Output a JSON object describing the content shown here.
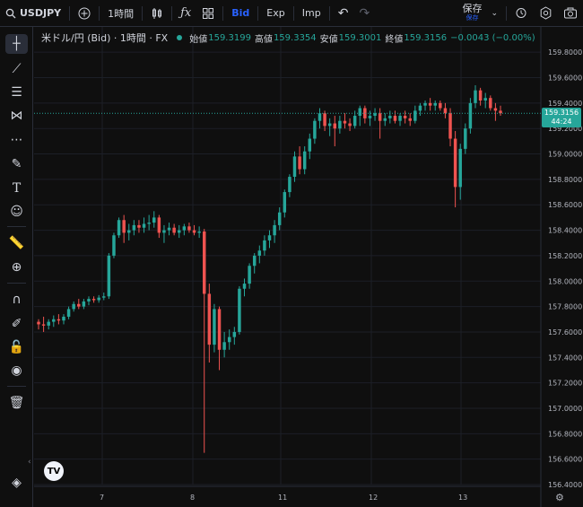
{
  "toolbar": {
    "symbol": "USDJPY",
    "interval": "1時間",
    "bid": "Bid",
    "exp": "Exp",
    "imp": "Imp",
    "save_label": "保存",
    "save_sub": "保存",
    "accent": "#2962ff"
  },
  "legend": {
    "title": "米ドル/円 (Bid) · 1時間 · FX",
    "open_label": "始値",
    "open": "159.3199",
    "high_label": "高値",
    "high": "159.3354",
    "low_label": "安値",
    "low": "159.3001",
    "close_label": "終値",
    "close": "159.3156",
    "change": "−0.0043 (−0.00%)"
  },
  "price_tag": {
    "price": "159.3156",
    "countdown": "44:24",
    "color": "#26a69a"
  },
  "sidebar_icons": [
    "crosshair-icon",
    "trendline-icon",
    "fib-icon",
    "pattern-icon",
    "measure-icon",
    "brush-icon",
    "text-icon",
    "emoji-icon",
    "ruler-icon",
    "zoom-in-icon",
    "magnet-icon",
    "lock-drawing-icon",
    "lock-icon",
    "eye-icon",
    "trash-icon",
    "layers-icon"
  ],
  "chart_data": {
    "type": "candlestick",
    "title": "米ドル/円 (Bid) · 1時間 · FX",
    "ylim": [
      156.4,
      159.9
    ],
    "y_ticks": [
      "159.8000",
      "159.6000",
      "159.4000",
      "159.2000",
      "159.0000",
      "158.8000",
      "158.6000",
      "158.4000",
      "158.2000",
      "158.0000",
      "157.8000",
      "157.6000",
      "157.4000",
      "157.2000",
      "157.0000",
      "156.8000",
      "156.6000",
      "156.4000"
    ],
    "x_ticks": [
      "7",
      "8",
      "11",
      "12",
      "13"
    ],
    "up_color": "#26a69a",
    "down_color": "#ef5350",
    "candles": [
      [
        157.68,
        157.7,
        157.62,
        157.66
      ],
      [
        157.66,
        157.72,
        157.6,
        157.65
      ],
      [
        157.65,
        157.7,
        157.62,
        157.68
      ],
      [
        157.68,
        157.73,
        157.64,
        157.7
      ],
      [
        157.7,
        157.74,
        157.66,
        157.69
      ],
      [
        157.69,
        157.74,
        157.66,
        157.72
      ],
      [
        157.72,
        157.8,
        157.7,
        157.78
      ],
      [
        157.78,
        157.84,
        157.76,
        157.82
      ],
      [
        157.82,
        157.86,
        157.78,
        157.8
      ],
      [
        157.8,
        157.86,
        157.78,
        157.84
      ],
      [
        157.84,
        157.88,
        157.81,
        157.86
      ],
      [
        157.86,
        157.88,
        157.83,
        157.85
      ],
      [
        157.85,
        157.89,
        157.83,
        157.87
      ],
      [
        157.87,
        157.91,
        157.85,
        157.88
      ],
      [
        157.88,
        158.22,
        157.86,
        158.2
      ],
      [
        158.2,
        158.38,
        158.18,
        158.36
      ],
      [
        158.36,
        158.5,
        158.34,
        158.48
      ],
      [
        158.48,
        158.52,
        158.3,
        158.38
      ],
      [
        158.38,
        158.45,
        158.32,
        158.4
      ],
      [
        158.4,
        158.48,
        158.36,
        158.44
      ],
      [
        158.44,
        158.48,
        158.38,
        158.42
      ],
      [
        158.42,
        158.5,
        158.38,
        158.45
      ],
      [
        158.45,
        158.52,
        158.4,
        158.46
      ],
      [
        158.46,
        158.55,
        158.42,
        158.5
      ],
      [
        158.5,
        158.52,
        158.34,
        158.38
      ],
      [
        158.38,
        158.44,
        158.3,
        158.4
      ],
      [
        158.4,
        158.46,
        158.36,
        158.42
      ],
      [
        158.42,
        158.45,
        158.36,
        158.38
      ],
      [
        158.38,
        158.44,
        158.34,
        158.4
      ],
      [
        158.4,
        158.45,
        158.36,
        158.43
      ],
      [
        158.43,
        158.46,
        158.38,
        158.4
      ],
      [
        158.4,
        158.44,
        158.36,
        158.38
      ],
      [
        158.38,
        158.43,
        158.34,
        158.39
      ],
      [
        158.39,
        158.41,
        156.65,
        157.9
      ],
      [
        157.9,
        157.98,
        157.36,
        157.5
      ],
      [
        157.5,
        157.82,
        157.44,
        157.78
      ],
      [
        157.78,
        157.8,
        157.3,
        157.46
      ],
      [
        157.46,
        157.6,
        157.4,
        157.52
      ],
      [
        157.52,
        157.62,
        157.46,
        157.56
      ],
      [
        157.56,
        157.64,
        157.5,
        157.6
      ],
      [
        157.6,
        157.96,
        157.58,
        157.94
      ],
      [
        157.94,
        158.02,
        157.88,
        157.98
      ],
      [
        157.98,
        158.14,
        157.94,
        158.12
      ],
      [
        158.12,
        158.22,
        158.06,
        158.2
      ],
      [
        158.2,
        158.28,
        158.14,
        158.24
      ],
      [
        158.24,
        158.36,
        158.2,
        158.32
      ],
      [
        158.32,
        158.4,
        158.26,
        158.36
      ],
      [
        158.36,
        158.48,
        158.3,
        158.44
      ],
      [
        158.44,
        158.58,
        158.4,
        158.54
      ],
      [
        158.54,
        158.72,
        158.5,
        158.7
      ],
      [
        158.7,
        158.84,
        158.66,
        158.82
      ],
      [
        158.82,
        159.02,
        158.78,
        158.98
      ],
      [
        158.98,
        159.06,
        158.84,
        158.88
      ],
      [
        158.88,
        159.06,
        158.84,
        159.02
      ],
      [
        159.02,
        159.16,
        158.96,
        159.12
      ],
      [
        159.12,
        159.28,
        159.08,
        159.26
      ],
      [
        159.26,
        159.36,
        159.2,
        159.32
      ],
      [
        159.32,
        159.34,
        159.18,
        159.22
      ],
      [
        159.22,
        159.28,
        159.14,
        159.24
      ],
      [
        159.24,
        159.3,
        159.06,
        159.2
      ],
      [
        159.2,
        159.3,
        159.16,
        159.26
      ],
      [
        159.26,
        159.32,
        159.2,
        159.24
      ],
      [
        159.24,
        159.28,
        159.18,
        159.22
      ],
      [
        159.22,
        159.34,
        159.2,
        159.3
      ],
      [
        159.3,
        159.38,
        159.22,
        159.36
      ],
      [
        159.36,
        159.38,
        159.24,
        159.28
      ],
      [
        159.28,
        159.34,
        159.22,
        159.3
      ],
      [
        159.3,
        159.36,
        159.26,
        159.32
      ],
      [
        159.32,
        159.36,
        159.12,
        159.26
      ],
      [
        159.26,
        159.32,
        159.22,
        159.28
      ],
      [
        159.28,
        159.34,
        159.24,
        159.3
      ],
      [
        159.3,
        159.34,
        159.24,
        159.26
      ],
      [
        159.26,
        159.32,
        159.22,
        159.3
      ],
      [
        159.3,
        159.34,
        159.24,
        159.28
      ],
      [
        159.28,
        159.32,
        159.22,
        159.26
      ],
      [
        159.26,
        159.38,
        159.24,
        159.34
      ],
      [
        159.34,
        159.4,
        159.3,
        159.38
      ],
      [
        159.38,
        159.42,
        159.34,
        159.4
      ],
      [
        159.4,
        159.44,
        159.34,
        159.38
      ],
      [
        159.38,
        159.42,
        159.34,
        159.4
      ],
      [
        159.4,
        159.42,
        159.34,
        159.36
      ],
      [
        159.36,
        159.4,
        159.28,
        159.32
      ],
      [
        159.32,
        159.36,
        159.06,
        159.12
      ],
      [
        159.12,
        159.18,
        158.58,
        158.74
      ],
      [
        158.74,
        159.08,
        158.64,
        159.04
      ],
      [
        159.04,
        159.24,
        159.0,
        159.2
      ],
      [
        159.2,
        159.44,
        159.16,
        159.4
      ],
      [
        159.4,
        159.54,
        159.36,
        159.5
      ],
      [
        159.5,
        159.52,
        159.38,
        159.42
      ],
      [
        159.42,
        159.48,
        159.36,
        159.44
      ],
      [
        159.44,
        159.46,
        159.34,
        159.36
      ],
      [
        159.36,
        159.4,
        159.26,
        159.34
      ],
      [
        159.34,
        159.38,
        159.3,
        159.32
      ]
    ]
  }
}
